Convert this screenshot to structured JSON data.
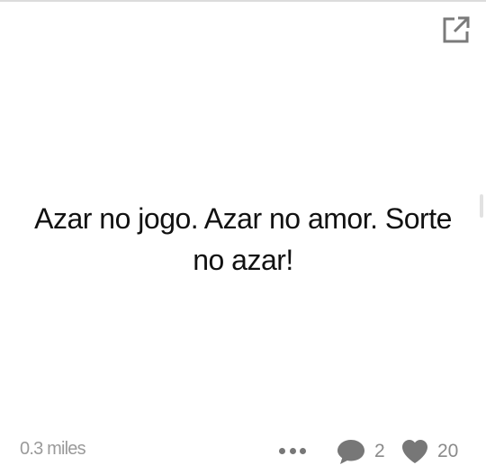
{
  "post": {
    "text": "Azar no jogo. Azar no amor. Sorte no azar!"
  },
  "footer": {
    "distance": "0.3 miles",
    "comment_count": "2",
    "like_count": "20"
  },
  "icons": {
    "share": "share-external-icon",
    "more": "more-dots-icon",
    "comment": "comment-bubble-icon",
    "like": "heart-icon"
  },
  "colors": {
    "icon_gray": "#777777",
    "text_dark": "#111111",
    "text_muted": "#9a9a9a"
  }
}
